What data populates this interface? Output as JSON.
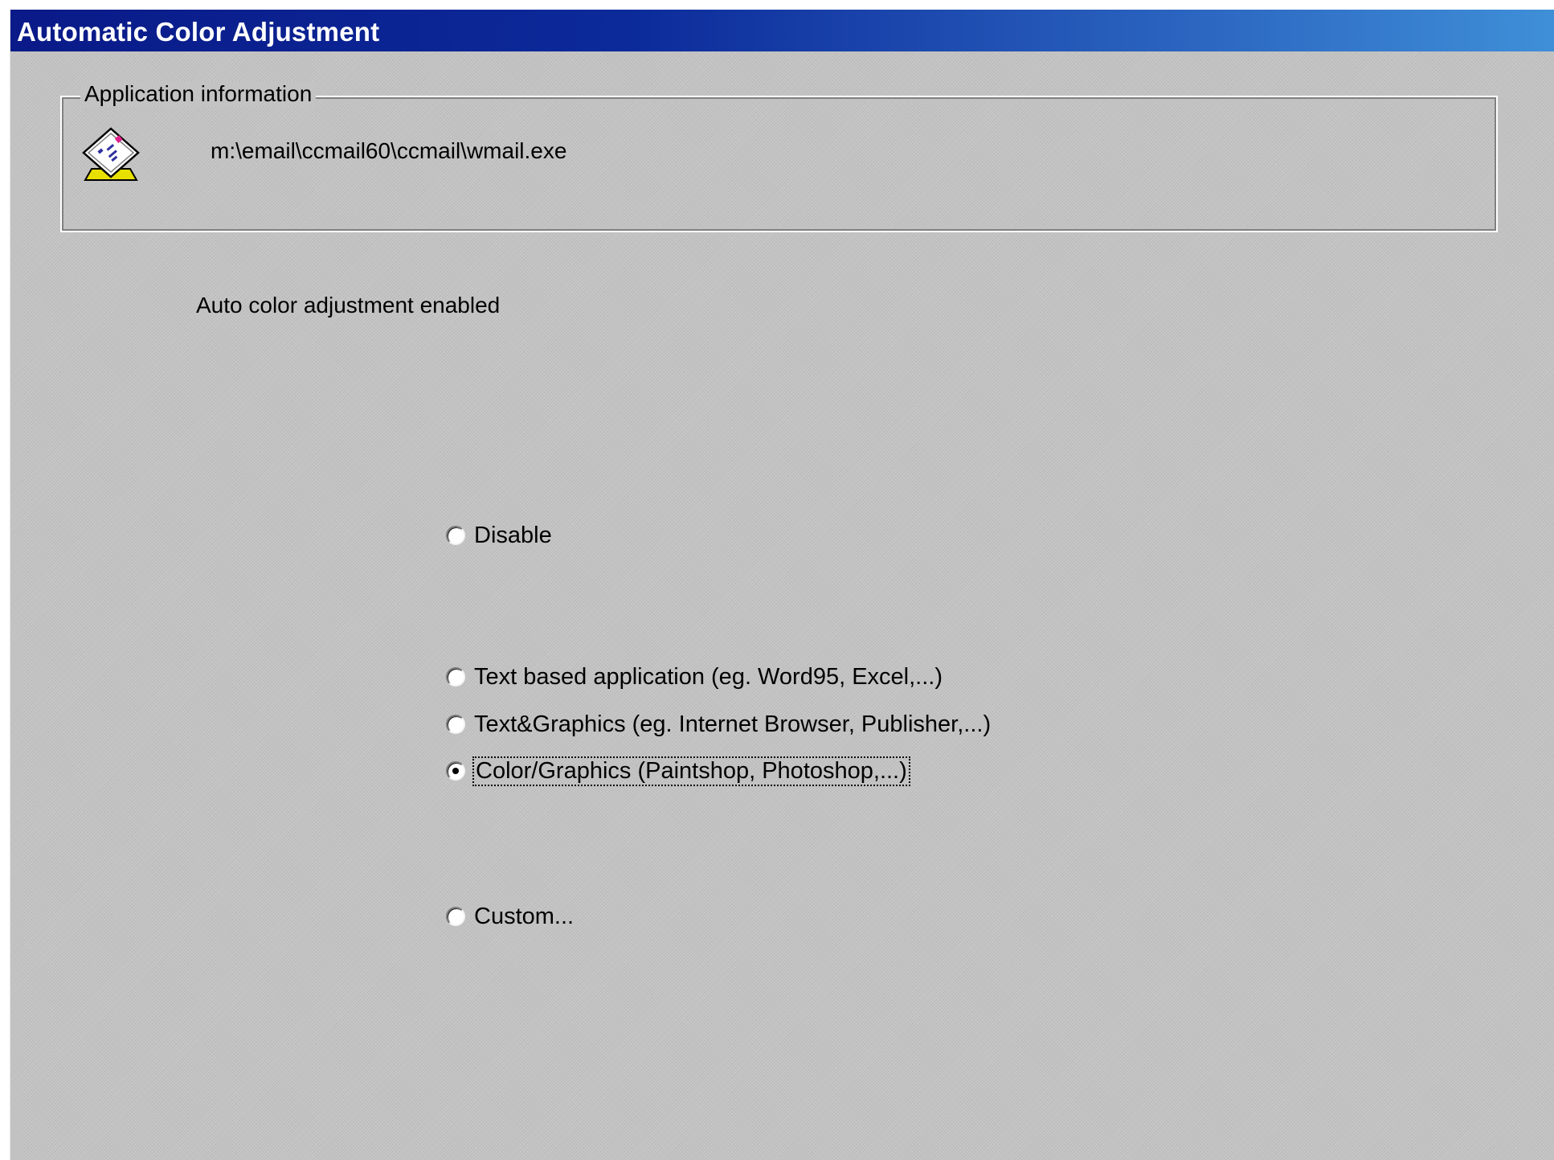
{
  "window": {
    "title": "Automatic Color Adjustment"
  },
  "application_info": {
    "group_label": "Application information",
    "icon": "cc-mail-envelope-icon",
    "path": "m:\\email\\ccmail60\\ccmail\\wmail.exe"
  },
  "status": {
    "text": "Auto color adjustment enabled"
  },
  "options": [
    {
      "label": "Disable",
      "selected": false
    },
    {
      "label": "Text based application (eg. Word95, Excel,...)",
      "selected": false
    },
    {
      "label": "Text&Graphics (eg. Internet Browser, Publisher,...)",
      "selected": false
    },
    {
      "label": "Color/Graphics (Paintshop, Photoshop,...)",
      "selected": true
    },
    {
      "label": "Custom...",
      "selected": false
    }
  ],
  "colors": {
    "title_bar_start": "#0a1a88",
    "title_bar_end": "#3f8fd8",
    "dialog_background": "#c3c3c3"
  }
}
